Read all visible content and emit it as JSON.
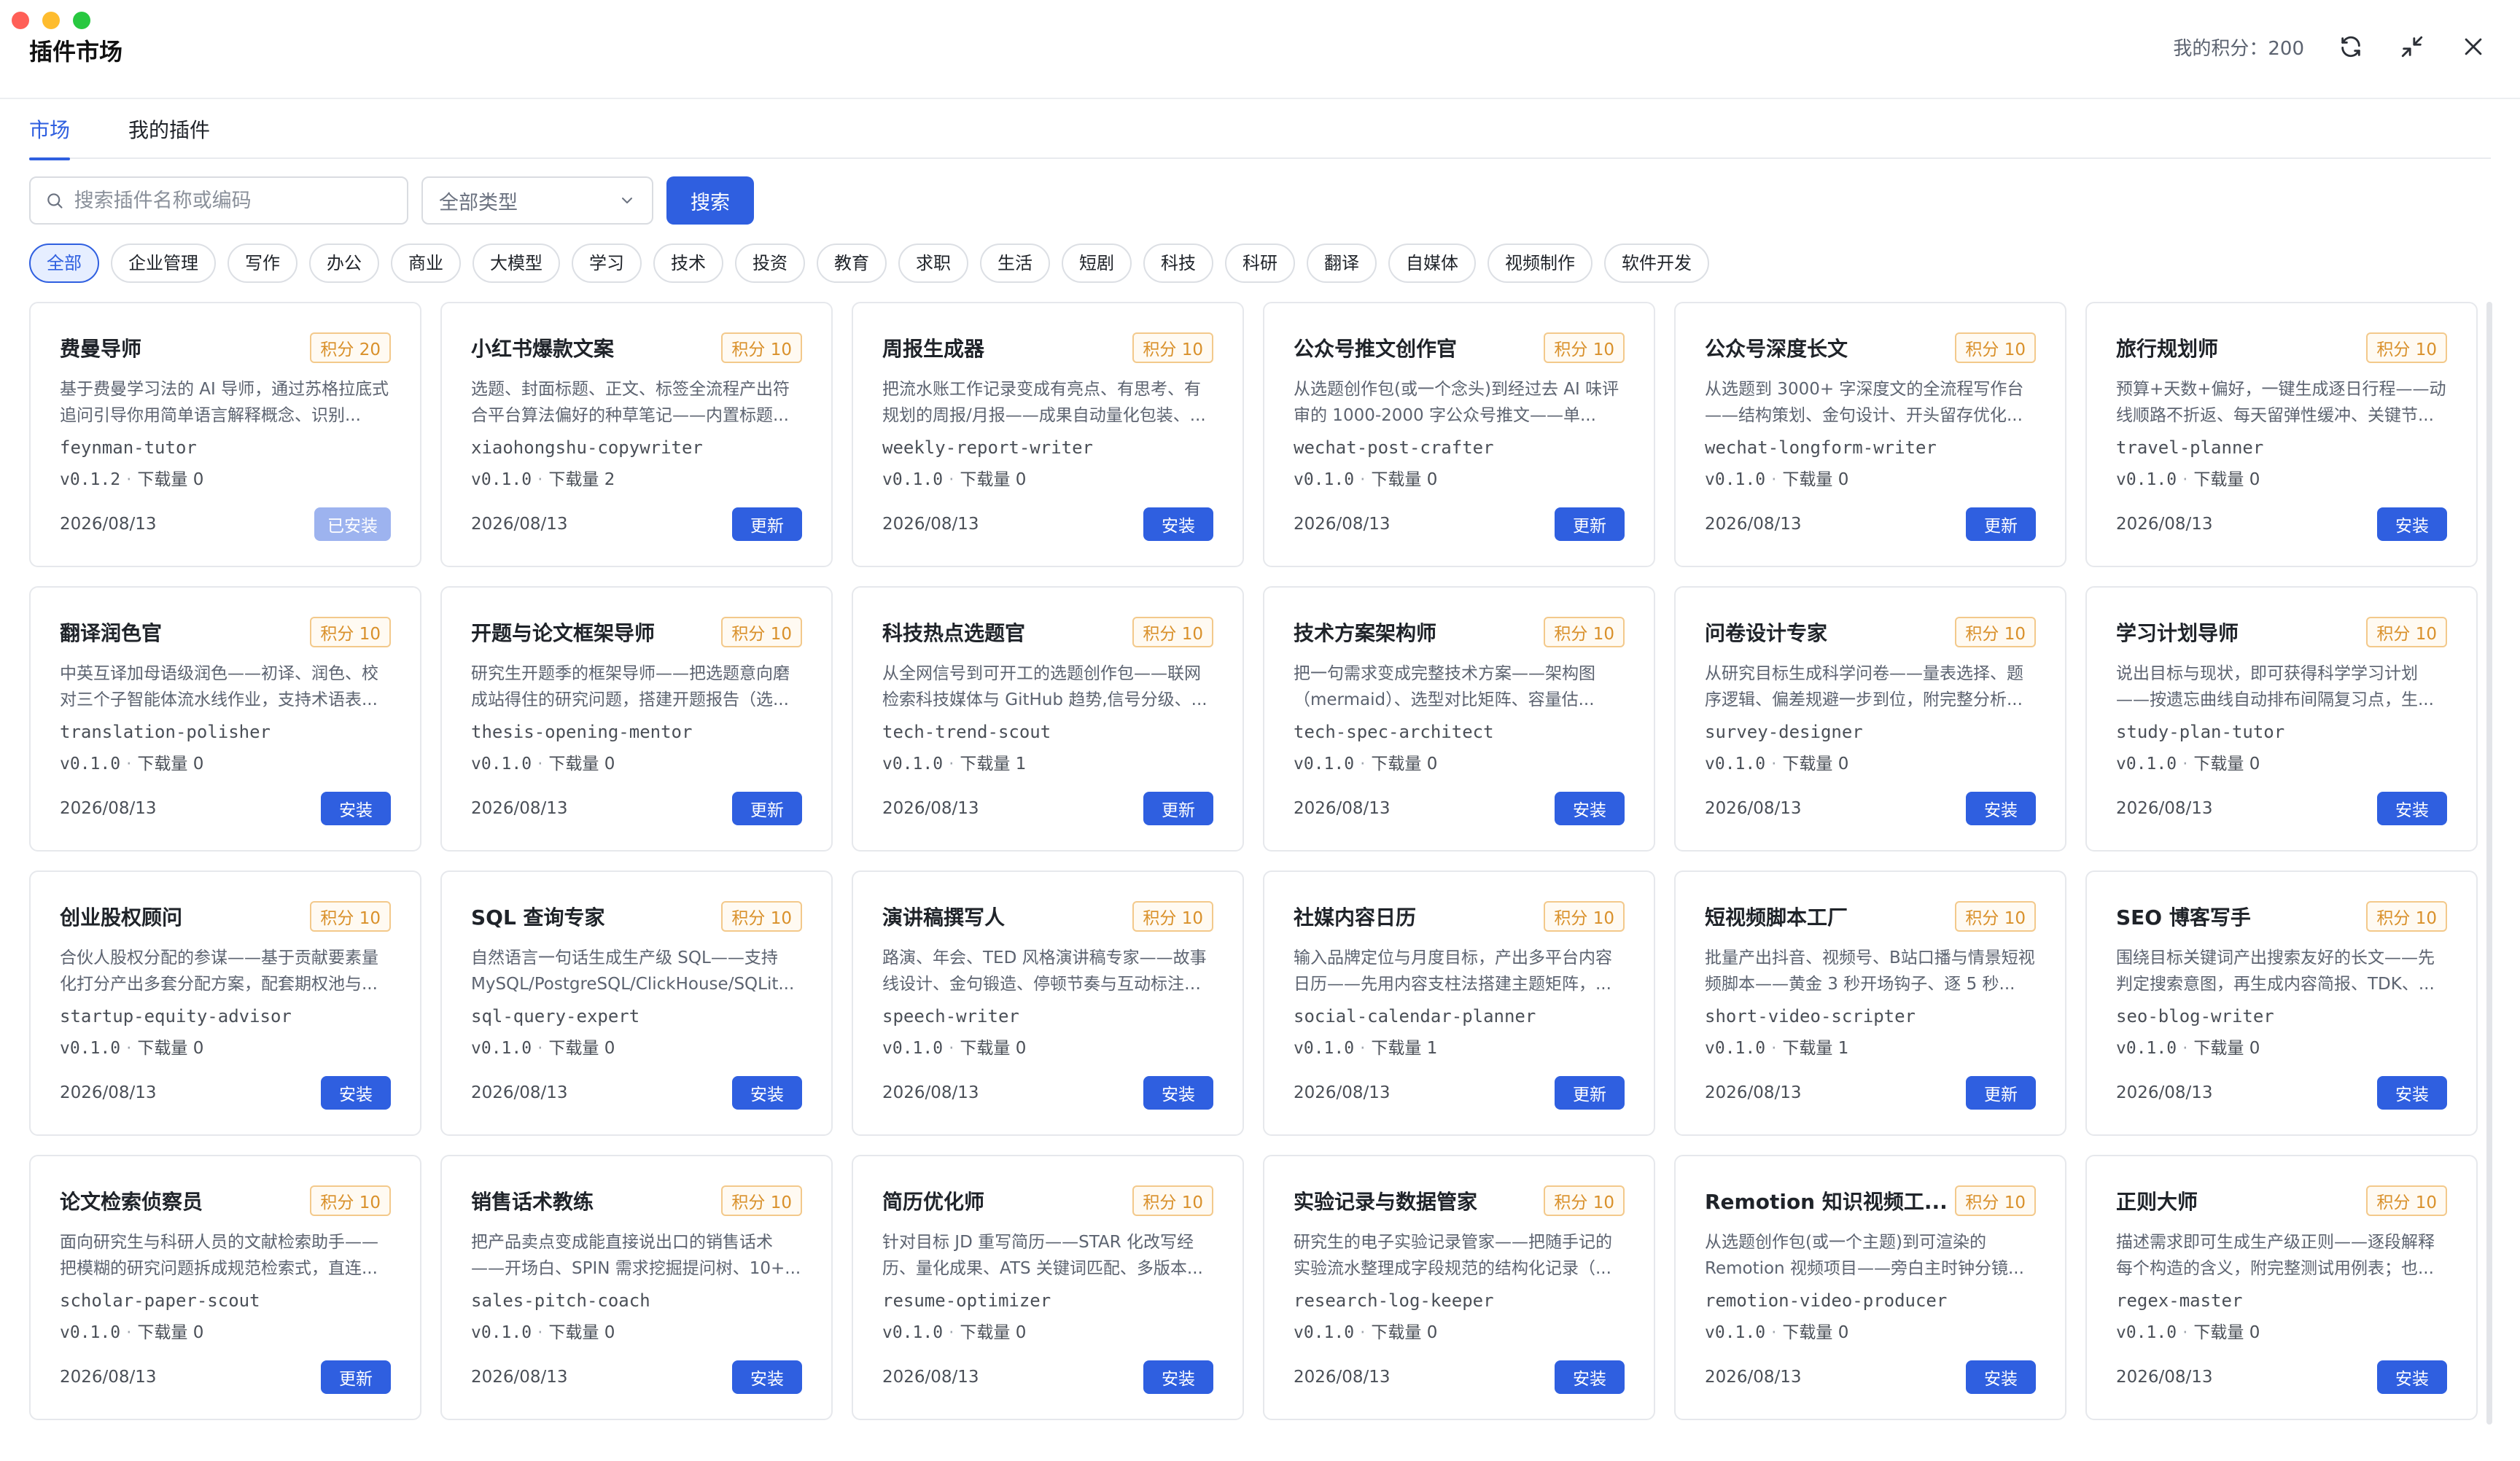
{
  "window": {
    "title": "插件市场"
  },
  "header": {
    "points_label": "我的积分：200"
  },
  "tabs": [
    {
      "label": "市场",
      "active": true
    },
    {
      "label": "我的插件",
      "active": false
    }
  ],
  "search": {
    "placeholder": "搜索插件名称或编码",
    "value": "",
    "type_select": "全部类型",
    "button": "搜索"
  },
  "chips": [
    {
      "label": "全部",
      "active": true
    },
    {
      "label": "企业管理"
    },
    {
      "label": "写作"
    },
    {
      "label": "办公"
    },
    {
      "label": "商业"
    },
    {
      "label": "大模型"
    },
    {
      "label": "学习"
    },
    {
      "label": "技术"
    },
    {
      "label": "投资"
    },
    {
      "label": "教育"
    },
    {
      "label": "求职"
    },
    {
      "label": "生活"
    },
    {
      "label": "短剧"
    },
    {
      "label": "科技"
    },
    {
      "label": "科研"
    },
    {
      "label": "翻译"
    },
    {
      "label": "自媒体"
    },
    {
      "label": "视频制作"
    },
    {
      "label": "软件开发"
    }
  ],
  "cards": [
    {
      "title": "费曼导师",
      "points": "积分 20",
      "desc": "基于费曼学习法的 AI 导师，通过苏格拉底式追问引导你用简单语言解释概念、识别...",
      "code": "feynman-tutor",
      "version": "v0.1.2",
      "downloads": "下载量 0",
      "date": "2026/08/13",
      "action": "已安装",
      "installed": true
    },
    {
      "title": "小红书爆款文案",
      "points": "积分 10",
      "desc": "选题、封面标题、正文、标签全流程产出符合平台算法偏好的种草笔记——内置标题...",
      "code": "xiaohongshu-copywriter",
      "version": "v0.1.0",
      "downloads": "下载量 2",
      "date": "2026/08/13",
      "action": "更新"
    },
    {
      "title": "周报生成器",
      "points": "积分 10",
      "desc": "把流水账工作记录变成有亮点、有思考、有规划的周报/月报——成果自动量化包装、...",
      "code": "weekly-report-writer",
      "version": "v0.1.0",
      "downloads": "下载量 0",
      "date": "2026/08/13",
      "action": "安装"
    },
    {
      "title": "公众号推文创作官",
      "points": "积分 10",
      "desc": "从选题创作包(或一个念头)到经过去 AI 味评审的 1000-2000 字公众号推文——单...",
      "code": "wechat-post-crafter",
      "version": "v0.1.0",
      "downloads": "下载量 0",
      "date": "2026/08/13",
      "action": "更新"
    },
    {
      "title": "公众号深度长文",
      "points": "积分 10",
      "desc": "从选题到 3000+ 字深度文的全流程写作台——结构策划、金句设计、开头留存优化...",
      "code": "wechat-longform-writer",
      "version": "v0.1.0",
      "downloads": "下载量 0",
      "date": "2026/08/13",
      "action": "更新"
    },
    {
      "title": "旅行规划师",
      "points": "积分 10",
      "desc": "预算+天数+偏好，一键生成逐日行程——动线顺路不折返、每天留弹性缓冲、关键节...",
      "code": "travel-planner",
      "version": "v0.1.0",
      "downloads": "下载量 0",
      "date": "2026/08/13",
      "action": "安装"
    },
    {
      "title": "翻译润色官",
      "points": "积分 10",
      "desc": "中英互译加母语级润色——初译、润色、校对三个子智能体流水线作业，支持术语表...",
      "code": "translation-polisher",
      "version": "v0.1.0",
      "downloads": "下载量 0",
      "date": "2026/08/13",
      "action": "安装"
    },
    {
      "title": "开题与论文框架导师",
      "points": "积分 10",
      "desc": "研究生开题季的框架导师——把选题意向磨成站得住的研究问题，搭建开题报告（选...",
      "code": "thesis-opening-mentor",
      "version": "v0.1.0",
      "downloads": "下载量 0",
      "date": "2026/08/13",
      "action": "更新"
    },
    {
      "title": "科技热点选题官",
      "points": "积分 10",
      "desc": "从全网信号到可开工的选题创作包——联网检索科技媒体与 GitHub 趋势,信号分级、...",
      "code": "tech-trend-scout",
      "version": "v0.1.0",
      "downloads": "下载量 1",
      "date": "2026/08/13",
      "action": "更新"
    },
    {
      "title": "技术方案架构师",
      "points": "积分 10",
      "desc": "把一句需求变成完整技术方案——架构图（mermaid）、选型对比矩阵、容量估...",
      "code": "tech-spec-architect",
      "version": "v0.1.0",
      "downloads": "下载量 0",
      "date": "2026/08/13",
      "action": "安装"
    },
    {
      "title": "问卷设计专家",
      "points": "积分 10",
      "desc": "从研究目标生成科学问卷——量表选择、题序逻辑、偏差规避一步到位，附完整分析...",
      "code": "survey-designer",
      "version": "v0.1.0",
      "downloads": "下载量 0",
      "date": "2026/08/13",
      "action": "安装"
    },
    {
      "title": "学习计划导师",
      "points": "积分 10",
      "desc": "说出目标与现状，即可获得科学学习计划——按遗忘曲线自动排布间隔复习点，生...",
      "code": "study-plan-tutor",
      "version": "v0.1.0",
      "downloads": "下载量 0",
      "date": "2026/08/13",
      "action": "安装"
    },
    {
      "title": "创业股权顾问",
      "points": "积分 10",
      "desc": "合伙人股权分配的参谋——基于贡献要素量化打分产出多套分配方案，配套期权池与...",
      "code": "startup-equity-advisor",
      "version": "v0.1.0",
      "downloads": "下载量 0",
      "date": "2026/08/13",
      "action": "安装"
    },
    {
      "title": "SQL 查询专家",
      "points": "积分 10",
      "desc": "自然语言一句话生成生产级 SQL——支持 MySQL/PostgreSQL/ClickHouse/SQLit...",
      "code": "sql-query-expert",
      "version": "v0.1.0",
      "downloads": "下载量 0",
      "date": "2026/08/13",
      "action": "安装"
    },
    {
      "title": "演讲稿撰写人",
      "points": "积分 10",
      "desc": "路演、年会、TED 风格演讲稿专家——故事线设计、金句锻造、停顿节奏与互动标注一站...",
      "code": "speech-writer",
      "version": "v0.1.0",
      "downloads": "下载量 0",
      "date": "2026/08/13",
      "action": "安装"
    },
    {
      "title": "社媒内容日历",
      "points": "积分 10",
      "desc": "输入品牌定位与月度目标，产出多平台内容日历——先用内容支柱法搭建主题矩阵，...",
      "code": "social-calendar-planner",
      "version": "v0.1.0",
      "downloads": "下载量 1",
      "date": "2026/08/13",
      "action": "更新"
    },
    {
      "title": "短视频脚本工厂",
      "points": "积分 10",
      "desc": "批量产出抖音、视频号、B站口播与情景短视频脚本——黄金 3 秒开场钩子、逐 5 秒...",
      "code": "short-video-scripter",
      "version": "v0.1.0",
      "downloads": "下载量 1",
      "date": "2026/08/13",
      "action": "更新"
    },
    {
      "title": "SEO 博客写手",
      "points": "积分 10",
      "desc": "围绕目标关键词产出搜索友好的长文——先判定搜索意图，再生成内容简报、TDK、...",
      "code": "seo-blog-writer",
      "version": "v0.1.0",
      "downloads": "下载量 0",
      "date": "2026/08/13",
      "action": "安装"
    },
    {
      "title": "论文检索侦察员",
      "points": "积分 10",
      "desc": "面向研究生与科研人员的文献检索助手——把模糊的研究问题拆成规范检索式，直连...",
      "code": "scholar-paper-scout",
      "version": "v0.1.0",
      "downloads": "下载量 0",
      "date": "2026/08/13",
      "action": "更新"
    },
    {
      "title": "销售话术教练",
      "points": "积分 10",
      "desc": "把产品卖点变成能直接说出口的销售话术——开场白、SPIN 需求挖掘提问树、10+...",
      "code": "sales-pitch-coach",
      "version": "v0.1.0",
      "downloads": "下载量 0",
      "date": "2026/08/13",
      "action": "安装"
    },
    {
      "title": "简历优化师",
      "points": "积分 10",
      "desc": "针对目标 JD 重写简历——STAR 化改写经历、量化成果、ATS 关键词匹配、多版本...",
      "code": "resume-optimizer",
      "version": "v0.1.0",
      "downloads": "下载量 0",
      "date": "2026/08/13",
      "action": "安装"
    },
    {
      "title": "实验记录与数据管家",
      "points": "积分 10",
      "desc": "研究生的电子实验记录管家——把随手记的实验流水整理成字段规范的结构化记录（...",
      "code": "research-log-keeper",
      "version": "v0.1.0",
      "downloads": "下载量 0",
      "date": "2026/08/13",
      "action": "安装"
    },
    {
      "title": "Remotion 知识视频工...",
      "points": "积分 10",
      "desc": "从选题创作包(或一个主题)到可渲染的 Remotion 视频项目——旁白主时钟分镜...",
      "code": "remotion-video-producer",
      "version": "v0.1.0",
      "downloads": "下载量 0",
      "date": "2026/08/13",
      "action": "安装"
    },
    {
      "title": "正则大师",
      "points": "积分 10",
      "desc": "描述需求即可生成生产级正则——逐段解释每个构造的含义，附完整测试用例表；也...",
      "code": "regex-master",
      "version": "v0.1.0",
      "downloads": "下载量 0",
      "date": "2026/08/13",
      "action": "安装"
    }
  ]
}
